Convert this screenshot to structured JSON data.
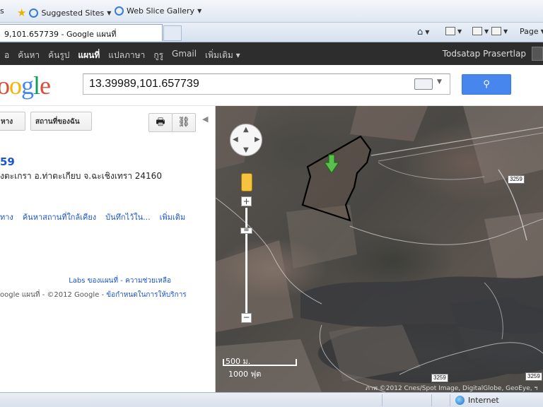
{
  "browser": {
    "favbar": {
      "left_fragment": "s",
      "suggested_sites": "Suggested Sites",
      "web_slice_gallery": "Web Slice Gallery"
    },
    "tab_title": "9,101.657739 - Google แผนที่",
    "command_bar": {
      "page_label": "Page"
    },
    "status": {
      "zone": "Internet"
    }
  },
  "gbar": {
    "links": [
      {
        "label": "อ",
        "active": false
      },
      {
        "label": "ค้นหา",
        "active": false
      },
      {
        "label": "ค้นรูป",
        "active": false
      },
      {
        "label": "แผนที่",
        "active": true
      },
      {
        "label": "แปลภาษา",
        "active": false
      },
      {
        "label": "กูรู",
        "active": false
      },
      {
        "label": "Gmail",
        "active": false
      },
      {
        "label": "เพิ่มเติม ▾",
        "active": false
      }
    ],
    "user": "Todsatap Prasertlap"
  },
  "search": {
    "logo_text": "oogle",
    "query": "13.39989,101.657739"
  },
  "panel": {
    "btn_directions": "หาง",
    "btn_my_places": "สถานที่ของฉัน",
    "result_title": "59",
    "address": "งตะเกรา อ.ท่าตะเกียบ จ.ฉะเชิงเทรา 24160",
    "actions": [
      "ทาง",
      "ค้นหาสถานที่ใกล้เคียง",
      "บันทึกไว้ใน...",
      "เพิ่มเติม"
    ],
    "footer_labs": "Labs ของแผนที่ - ความช่วยเหลือ",
    "footer_copy_prefix": "oogle แผนที่ - ©2012 Google - ",
    "footer_terms": "ข้อกำหนดในการให้บริการ"
  },
  "map": {
    "scale_metric": "500 ม.",
    "scale_imperial": "1000 ฟุต",
    "road_labels": [
      "3259",
      "3259",
      "3259"
    ],
    "copyright": "ภาพ ©2012 Cnes/Spot Image, DigitalGlobe, GeoEye, ฯ"
  }
}
